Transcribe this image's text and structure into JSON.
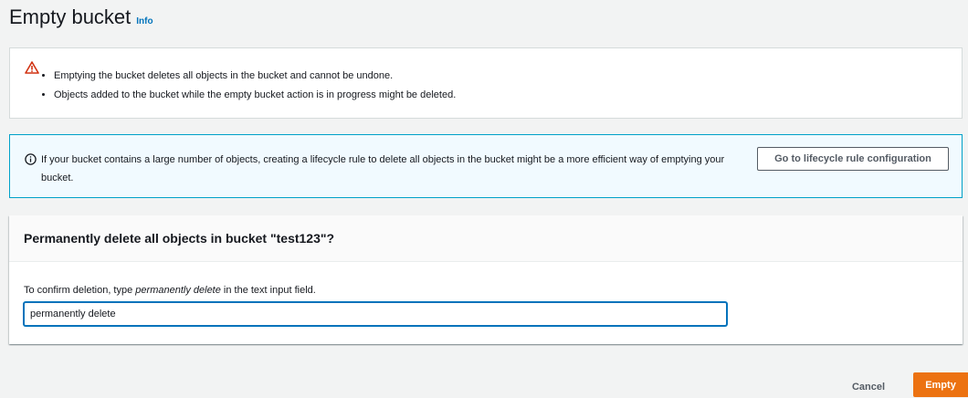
{
  "page": {
    "title": "Empty bucket",
    "info_link": "Info"
  },
  "warning": {
    "icon": "warning-triangle-icon",
    "icon_color": "#d13212",
    "items": [
      "Emptying the bucket deletes all objects in the bucket and cannot be undone.",
      "Objects added to the bucket while the empty bucket action is in progress might be deleted."
    ]
  },
  "info": {
    "icon": "info-circle-icon",
    "text": "If your bucket contains a large number of objects, creating a lifecycle rule to delete all objects in the bucket might be a more efficient way of emptying your bucket.",
    "button_label": "Go to lifecycle rule configuration"
  },
  "confirm": {
    "title": "Permanently delete all objects in bucket \"test123\"?",
    "instruction_prefix": "To confirm deletion, type ",
    "instruction_keyword": "permanently delete",
    "instruction_suffix": " in the text input field.",
    "input_value": "permanently delete"
  },
  "footer": {
    "cancel_label": "Cancel",
    "empty_label": "Empty"
  },
  "colors": {
    "accent": "#0073bb",
    "primary_button": "#ec7211",
    "warning": "#d13212"
  }
}
